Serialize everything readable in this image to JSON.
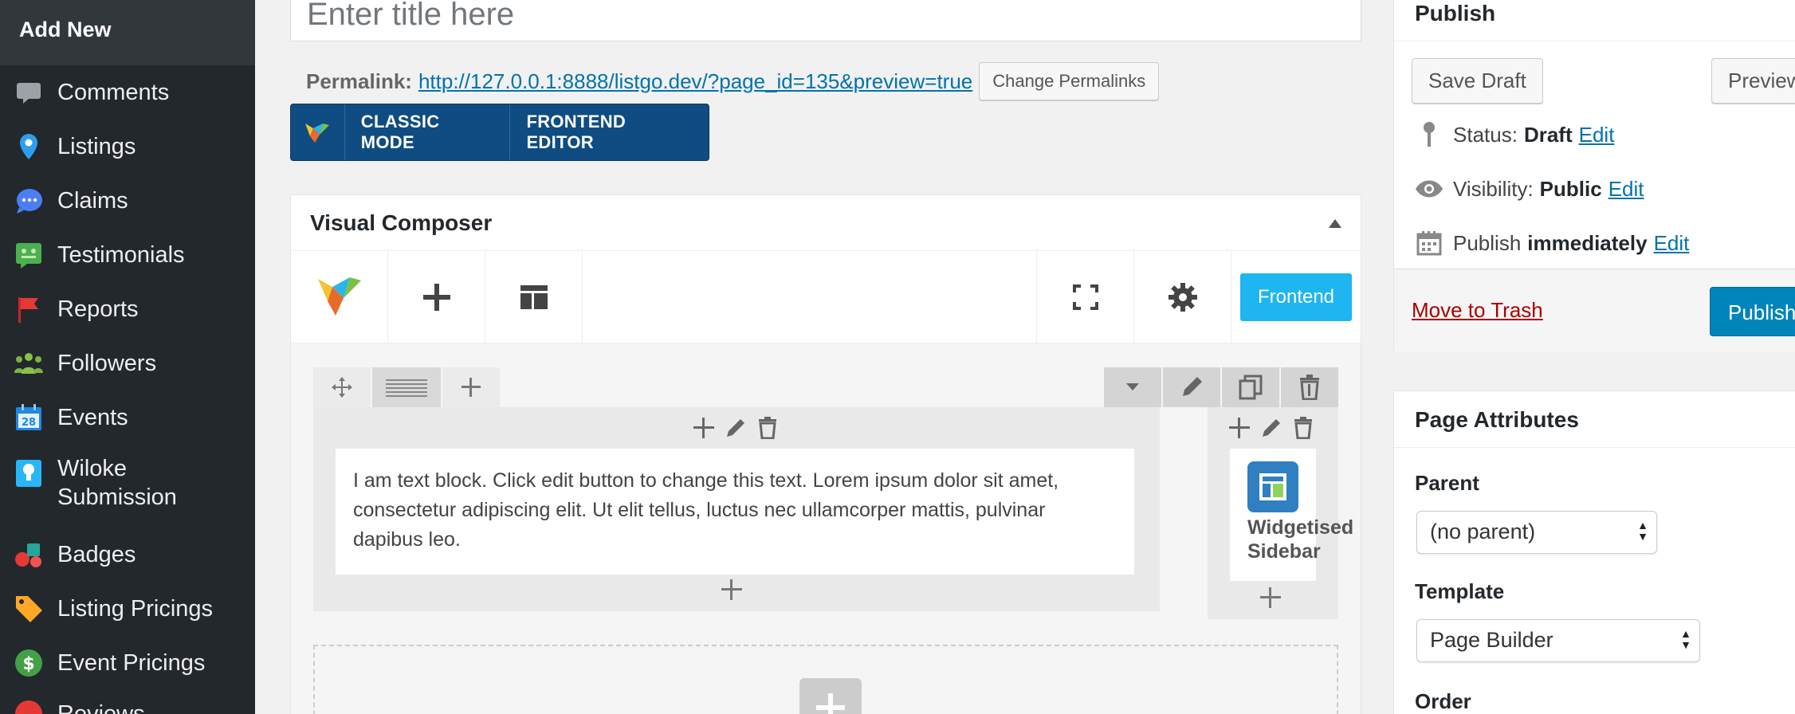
{
  "sidebar": {
    "add_new": "Add New",
    "items": [
      {
        "label": "Comments",
        "icon": "comment-icon"
      },
      {
        "label": "Listings",
        "icon": "map-pin-icon"
      },
      {
        "label": "Claims",
        "icon": "chat-bubble-icon"
      },
      {
        "label": "Testimonials",
        "icon": "testimonial-icon"
      },
      {
        "label": "Reports",
        "icon": "flag-icon"
      },
      {
        "label": "Followers",
        "icon": "people-icon"
      },
      {
        "label": "Events",
        "icon": "calendar-icon"
      },
      {
        "label": "Wiloke",
        "label2": "Submission",
        "icon": "bulb-icon"
      },
      {
        "label": "Badges",
        "icon": "badges-icon"
      },
      {
        "label": "Listing Pricings",
        "icon": "price-tag-icon"
      },
      {
        "label": "Event Pricings",
        "icon": "dollar-icon"
      },
      {
        "label": "Reviews",
        "icon": "reviews-icon"
      }
    ]
  },
  "editor": {
    "title_placeholder": "Enter title here",
    "permalink_label": "Permalink:",
    "permalink_url": "http://127.0.0.1:8888/listgo.dev/?page_id=135&preview=true",
    "change_permalinks": "Change Permalinks",
    "classic_mode": "CLASSIC MODE",
    "frontend_editor": "FRONTEND EDITOR"
  },
  "vc": {
    "title": "Visual Composer",
    "frontend_button": "Frontend",
    "text_block": "I am text block. Click edit button to change this text. Lorem ipsum dolor sit amet, consectetur adipiscing elit. Ut elit tellus, luctus nec ullamcorper mattis, pulvinar dapibus leo.",
    "widget_label_1": "Widgetised",
    "widget_label_2": "Sidebar"
  },
  "publish": {
    "title": "Publish",
    "save_draft": "Save Draft",
    "preview": "Preview",
    "status_label": "Status:",
    "status_value": "Draft",
    "visibility_label": "Visibility:",
    "visibility_value": "Public",
    "publish_label": "Publish",
    "publish_value": "immediately",
    "edit": "Edit",
    "move_to_trash": "Move to Trash",
    "publish_button": "Publish"
  },
  "page_attributes": {
    "title": "Page Attributes",
    "parent_label": "Parent",
    "parent_value": "(no parent)",
    "template_label": "Template",
    "template_value": "Page Builder",
    "order_label": "Order"
  },
  "colors": {
    "sidebar_bg": "#23282d",
    "mode_bar": "#0f4c81",
    "frontend_accent": "#1eb5f1",
    "publish_primary": "#0085ba",
    "trash_red": "#aa0000",
    "link_blue": "#0073aa"
  }
}
